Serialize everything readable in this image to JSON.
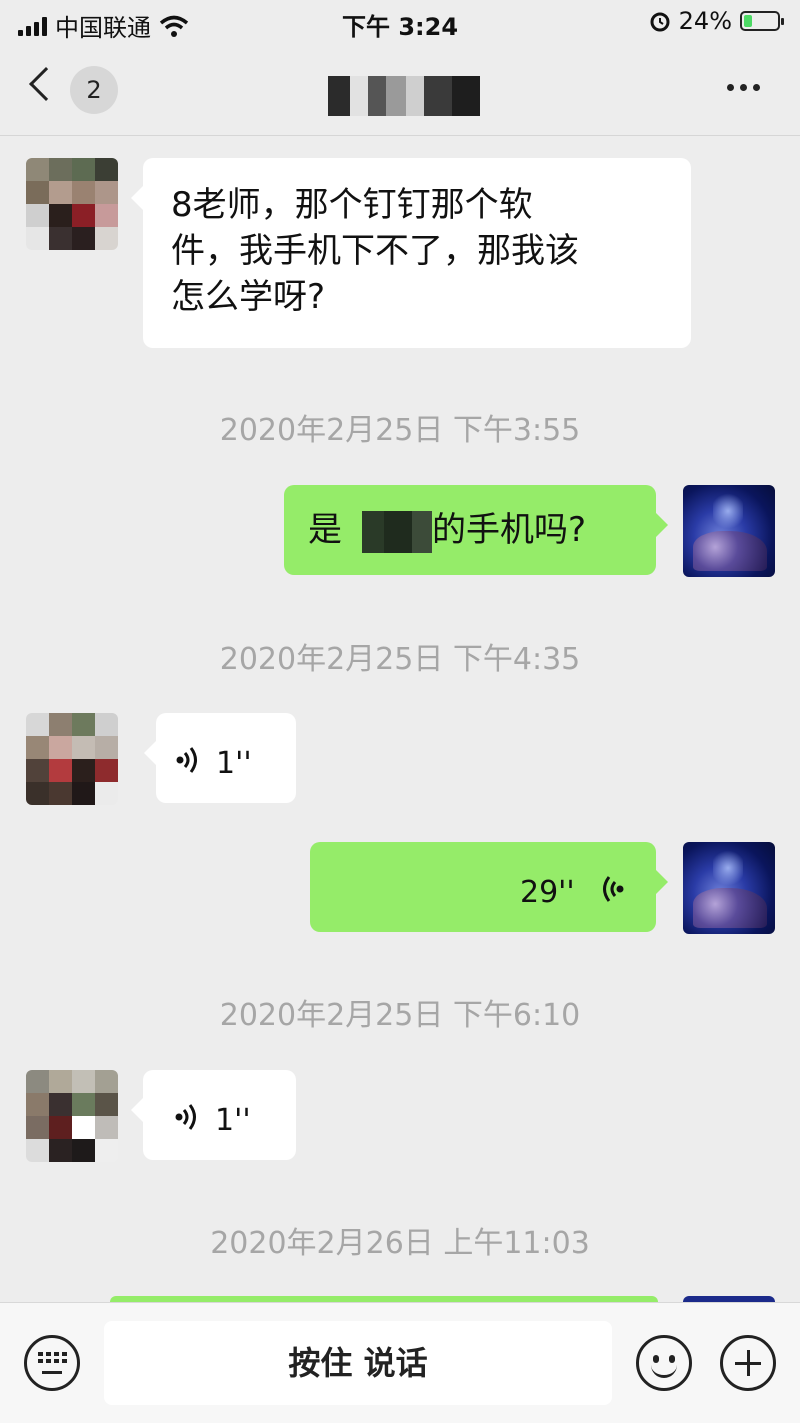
{
  "status_bar": {
    "carrier": "中国联通",
    "time": "下午 3:24",
    "battery_percent_label": "24%",
    "battery_level": 0.24,
    "icons": [
      "signal-icon",
      "wifi-icon",
      "alarm-icon",
      "battery-icon"
    ]
  },
  "nav": {
    "unread_count": "2",
    "icons": [
      "back-chevron-icon",
      "more-dots-icon"
    ]
  },
  "messages": [
    {
      "side": "left",
      "type": "text",
      "text": "8老师，那个钉钉那个软件，我手机下不了，那我该怎么学呀?",
      "text_lines": [
        "8老师，那个钉钉那个软",
        "件，我手机下不了，那我该",
        "怎么学呀?"
      ]
    },
    {
      "type": "timestamp",
      "text": "2020年2月25日 下午3:55"
    },
    {
      "side": "right",
      "type": "text",
      "text_before": "是",
      "text_after": "的手机吗?"
    },
    {
      "type": "timestamp",
      "text": "2020年2月25日 下午4:35"
    },
    {
      "side": "left",
      "type": "voice",
      "duration": "1''"
    },
    {
      "side": "right",
      "type": "voice",
      "duration": "29''"
    },
    {
      "type": "timestamp",
      "text": "2020年2月25日 下午6:10"
    },
    {
      "side": "left",
      "type": "voice",
      "duration": "1''"
    },
    {
      "type": "timestamp",
      "text": "2020年2月26日 上午11:03"
    }
  ],
  "input_bar": {
    "hold_to_talk": "按住 说话",
    "icons": [
      "keyboard-icon",
      "emoji-icon",
      "plus-icon"
    ]
  },
  "colors": {
    "background": "#ededed",
    "incoming_bubble": "#ffffff",
    "outgoing_bubble": "#95ec69",
    "timestamp_text": "#a6a6a6"
  }
}
